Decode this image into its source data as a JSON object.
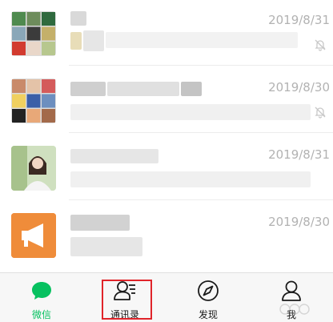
{
  "chats": [
    {
      "time": "2019/8/31",
      "muted": true
    },
    {
      "time": "2019/8/30",
      "muted": true
    },
    {
      "time": "2019/8/31",
      "muted": false
    },
    {
      "time": "2019/8/30",
      "muted": false
    }
  ],
  "tabbar": {
    "tabs": [
      {
        "label": "微信",
        "icon": "chat-bubble-icon",
        "active": true
      },
      {
        "label": "通讯录",
        "icon": "contacts-icon",
        "active": false
      },
      {
        "label": "发现",
        "icon": "compass-icon",
        "active": false
      },
      {
        "label": "我",
        "icon": "person-icon",
        "active": false
      }
    ]
  },
  "colors": {
    "accent": "#07c160",
    "highlight": "#e0242a",
    "time": "#b2b2b2",
    "orange_avatar": "#ef8c3a"
  }
}
